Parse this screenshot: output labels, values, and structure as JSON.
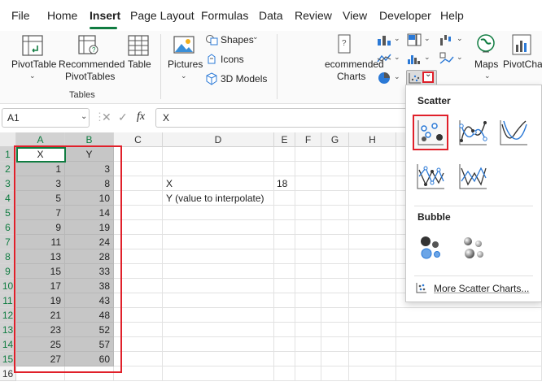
{
  "menu": {
    "items": [
      "File",
      "Home",
      "Insert",
      "Page Layout",
      "Formulas",
      "Data",
      "Review",
      "View",
      "Developer",
      "Help"
    ],
    "active": "Insert"
  },
  "ribbon": {
    "pivottable_label": "PivotTable",
    "recommended_pivot_line1": "Recommended",
    "recommended_pivot_line2": "PivotTables",
    "table_label": "Table",
    "tables_group_label": "Tables",
    "pictures_label": "Pictures",
    "shapes_label": "Shapes",
    "icons_label": "Icons",
    "models3d_label": "3D Models",
    "recommended_charts_line1": "ecommended",
    "recommended_charts_line2": "Charts",
    "maps_label": "Maps",
    "pivotchart_label": "PivotChar",
    "accent_color": "#107c41",
    "highlight_color": "#e0202a"
  },
  "formula_bar": {
    "name_box": "A1",
    "fx_symbol": "fx",
    "formula": "X"
  },
  "sheet": {
    "columns": [
      "A",
      "B",
      "C",
      "D",
      "E",
      "F",
      "G",
      "H"
    ],
    "rows": [
      "1",
      "2",
      "3",
      "4",
      "5",
      "6",
      "7",
      "8",
      "9",
      "10",
      "11",
      "12",
      "13",
      "14",
      "15",
      "16"
    ],
    "header_x": "X",
    "header_y": "Y",
    "data": [
      {
        "x": "1",
        "y": "3"
      },
      {
        "x": "3",
        "y": "8"
      },
      {
        "x": "5",
        "y": "10"
      },
      {
        "x": "7",
        "y": "14"
      },
      {
        "x": "9",
        "y": "19"
      },
      {
        "x": "11",
        "y": "24"
      },
      {
        "x": "13",
        "y": "28"
      },
      {
        "x": "15",
        "y": "33"
      },
      {
        "x": "17",
        "y": "38"
      },
      {
        "x": "19",
        "y": "43"
      },
      {
        "x": "21",
        "y": "48"
      },
      {
        "x": "23",
        "y": "52"
      },
      {
        "x": "25",
        "y": "57"
      },
      {
        "x": "27",
        "y": "60"
      }
    ],
    "d3": "X",
    "e3": "18",
    "d4": "Y (value to interpolate)"
  },
  "scatter_menu": {
    "scatter_title": "Scatter",
    "bubble_title": "Bubble",
    "more_link": "More Scatter Charts..."
  }
}
